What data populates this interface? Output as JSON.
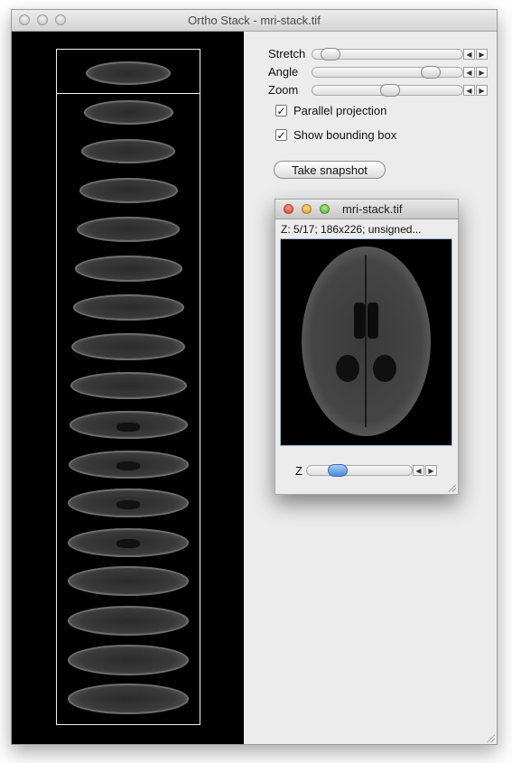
{
  "window": {
    "title": "Ortho Stack - mri-stack.tif"
  },
  "controls": {
    "stretch": {
      "label": "Stretch",
      "value": 0.07
    },
    "angle": {
      "label": "Angle",
      "value": 0.83
    },
    "zoom": {
      "label": "Zoom",
      "value": 0.52
    },
    "parallel_projection": {
      "label": "Parallel projection",
      "checked": true
    },
    "show_bounding_box": {
      "label": "Show bounding box",
      "checked": true
    },
    "snapshot_label": "Take snapshot"
  },
  "stack": {
    "slice_count": 17
  },
  "sub_window": {
    "title": "mri-stack.tif",
    "info": "Z: 5/17; 186x226; unsigned...",
    "z_label": "Z",
    "z_value": 0.25
  }
}
